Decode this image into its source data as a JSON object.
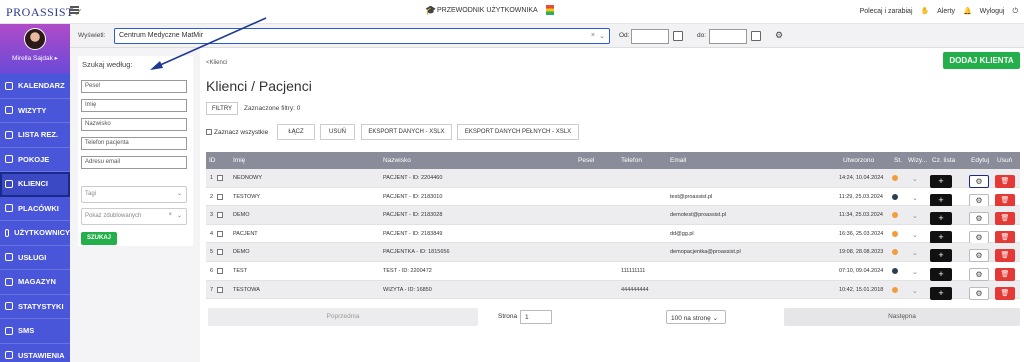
{
  "brand": {
    "logo_text": "PROASSIST",
    "logo_check": "✓"
  },
  "topbar": {
    "guide_label": "PRZEWODNIK UŻYTKOWNIKA",
    "refer_label": "Polecaj i zarabiaj",
    "alerts_label": "Alerty",
    "logout_label": "Wyloguj"
  },
  "profile": {
    "name": "Mirella Sajdak ▸"
  },
  "nav": {
    "items": [
      {
        "label": "KALENDARZ"
      },
      {
        "label": "WIZYTY"
      },
      {
        "label": "LISTA REZ."
      },
      {
        "label": "POKOJE"
      },
      {
        "label": "KLIENCI",
        "active": true
      },
      {
        "label": "PLACÓWKI"
      },
      {
        "label": "UŻYTKOWNICY"
      },
      {
        "label": "USŁUGI"
      },
      {
        "label": "MAGAZYN"
      },
      {
        "label": "STATYSTYKI"
      },
      {
        "label": "SMS"
      },
      {
        "label": "USTAWIENIA"
      }
    ]
  },
  "filterbar": {
    "show_label": "Wyświetl:",
    "clinic_value": "Centrum Medyczne MatMir",
    "from_label": "Od:",
    "to_label": "do:"
  },
  "search": {
    "title": "Szukaj według:",
    "fields": [
      "Pesel",
      "Imię",
      "Nazwisko",
      "Telefon pacjenta",
      "Adresu email"
    ],
    "tags_placeholder": "Tagi",
    "duplicates_placeholder": "Pokaż zdublowanych",
    "search_label": "SZUKAJ"
  },
  "main": {
    "breadcrumb": "<Klienci",
    "title": "Klienci / Pacjenci",
    "add_label": "DODAJ KLIENTA",
    "filters_label": "FILTRY",
    "filters_note": "Zaznaczone filtry: 0",
    "select_all": "Zaznacz wszystkie",
    "actions": [
      "ŁĄCZ",
      "USUŃ",
      "EKSPORT DANYCH - XSLX",
      "EKSPORT DANYCH PEŁNYCH - XSLX"
    ]
  },
  "table": {
    "headers": [
      "ID",
      "Imię",
      "Nazwisko",
      "Pesel",
      "Telefon",
      "Email",
      "Utworzono",
      "St.",
      "Wizy...",
      "Cz. lista",
      "Edytuj",
      "Usuń"
    ],
    "rows": [
      {
        "id": "1",
        "first": "NEONOWY",
        "last": "PACJENT - ID: 2204460",
        "pesel": "",
        "phone": "",
        "email": "",
        "created": "14:24, 10.04.2024",
        "status": "#f39c3c"
      },
      {
        "id": "2",
        "first": "TESTOWY",
        "last": "PACJENT - ID: 2183010",
        "pesel": "",
        "phone": "",
        "email": "test@proassist.pl",
        "created": "11:29, 25.03.2024",
        "status": "#2c3e50"
      },
      {
        "id": "3",
        "first": "DEMO",
        "last": "PACJENT - ID: 2183028",
        "pesel": "",
        "phone": "",
        "email": "demotest@proassist.pl",
        "created": "11:34, 25.03.2024",
        "status": "#f39c3c"
      },
      {
        "id": "4",
        "first": "PACJENT",
        "last": "PACJENT - ID: 2183849",
        "pesel": "",
        "phone": "",
        "email": "dd@gg.pl",
        "created": "16:36, 25.03.2024",
        "status": "#f39c3c"
      },
      {
        "id": "5",
        "first": "DEMO",
        "last": "PACJENTKA - ID: 1815656",
        "pesel": "",
        "phone": "",
        "email": "demopacjentka@proassist.pl",
        "created": "19:08, 28.08.2023",
        "status": "#f39c3c"
      },
      {
        "id": "6",
        "first": "TEST",
        "last": "TEST - ID: 2200472",
        "pesel": "",
        "phone": "111111111",
        "email": "",
        "created": "07:10, 09.04.2024",
        "status": "#2c3e50"
      },
      {
        "id": "7",
        "first": "TESTOWA",
        "last": "WIZYTA - ID: 16850",
        "pesel": "",
        "phone": "444444444",
        "email": "",
        "created": "10:42, 15.01.2018",
        "status": "#f39c3c"
      }
    ]
  },
  "pager": {
    "prev_label": "Poprzednia",
    "page_label": "Strona",
    "page_value": "1",
    "per_page": "100 na stronę",
    "next_label": "Następna"
  },
  "colors": {
    "accent": "#4a56d9",
    "success": "#23b04a",
    "danger": "#e53935"
  },
  "icons": [
    "hamburger-icon",
    "graduation-cap-icon",
    "book-icon",
    "bell-icon",
    "logout-icon",
    "calendar-icon",
    "gear-icon",
    "plus-icon",
    "trash-icon",
    "chevron-down-icon"
  ]
}
